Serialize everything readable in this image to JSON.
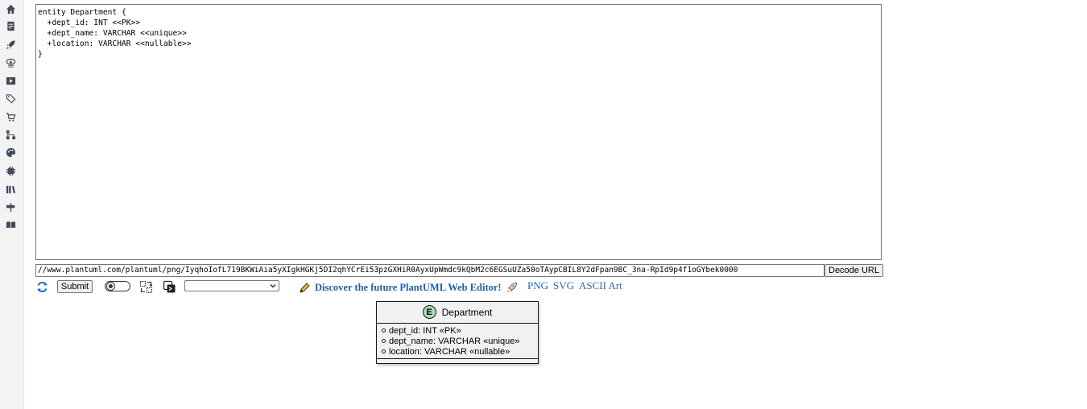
{
  "sidebar": {
    "icons": [
      "home-icon",
      "document-icon",
      "rocket-icon",
      "cloud-icon",
      "play-icon",
      "tags-icon",
      "cart-icon",
      "sitemap-icon",
      "palette-icon",
      "chip-icon",
      "library-icon",
      "signpost-icon",
      "book-icon"
    ]
  },
  "editor": {
    "source": "entity Department {\n  +dept_id: INT <<PK>>\n  +dept_name: VARCHAR <<unique>>\n  +location: VARCHAR <<nullable>>\n}"
  },
  "url_bar": {
    "value": "//www.plantuml.com/plantuml/png/IyqhoIofL719BKWiAia5yXIgkHGKj5DI2qhYCrEi53pzGXHiR0AyxUpWmdc9kQbM2c6EGSuUZa50oTAypCBIL8Y2dFpan9BC_3na-RpId9p4f1oGYbek0000",
    "decode_label": "Decode URL"
  },
  "toolbar": {
    "submit_label": "Submit",
    "select_value": "",
    "future_link": "Discover the future PlantUML Web Editor!",
    "formats": {
      "png": "PNG",
      "svg": "SVG",
      "ascii": "ASCII Art"
    }
  },
  "diagram": {
    "entity_badge": "E",
    "entity_name": "Department",
    "fields": [
      "dept_id: INT «PK»",
      "dept_name: VARCHAR «unique»",
      "location: VARCHAR «nullable»"
    ]
  },
  "colors": {
    "link": "#2769c4",
    "future_link": "#1f5fa6",
    "entity_badge": "#a9dcb2",
    "sidebar_icon": "#3f4a5a"
  }
}
